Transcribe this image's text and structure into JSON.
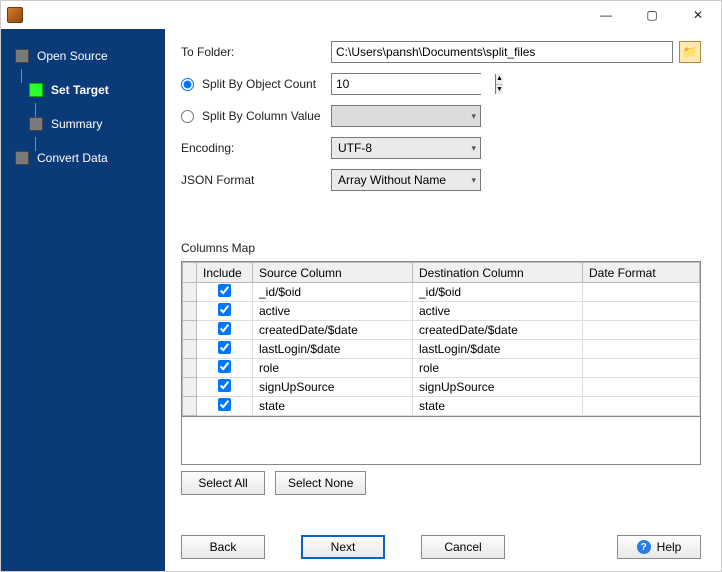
{
  "window": {
    "minimize": "—",
    "maximize": "▢",
    "close": "✕"
  },
  "sidebar": {
    "items": [
      {
        "label": "Open Source"
      },
      {
        "label": "Set Target"
      },
      {
        "label": "Summary"
      },
      {
        "label": "Convert Data"
      }
    ]
  },
  "form": {
    "to_folder_label": "To Folder:",
    "to_folder_value": "C:\\Users\\pansh\\Documents\\split_files",
    "split_count_label": "Split By Object Count",
    "split_count_value": "10",
    "split_column_label": "Split By Column Value",
    "split_column_value": "",
    "encoding_label": "Encoding:",
    "encoding_value": "UTF-8",
    "json_format_label": "JSON Format",
    "json_format_value": "Array Without Name"
  },
  "columns_map": {
    "title": "Columns Map",
    "headers": {
      "include": "Include",
      "source": "Source Column",
      "dest": "Destination Column",
      "datefmt": "Date Format"
    },
    "rows": [
      {
        "include": true,
        "source": "_id/$oid",
        "dest": "_id/$oid",
        "datefmt": ""
      },
      {
        "include": true,
        "source": "active",
        "dest": "active",
        "datefmt": ""
      },
      {
        "include": true,
        "source": "createdDate/$date",
        "dest": "createdDate/$date",
        "datefmt": ""
      },
      {
        "include": true,
        "source": "lastLogin/$date",
        "dest": "lastLogin/$date",
        "datefmt": ""
      },
      {
        "include": true,
        "source": "role",
        "dest": "role",
        "datefmt": ""
      },
      {
        "include": true,
        "source": "signUpSource",
        "dest": "signUpSource",
        "datefmt": ""
      },
      {
        "include": true,
        "source": "state",
        "dest": "state",
        "datefmt": ""
      }
    ]
  },
  "buttons": {
    "select_all": "Select All",
    "select_none": "Select None",
    "back": "Back",
    "next": "Next",
    "cancel": "Cancel",
    "help": "Help"
  }
}
